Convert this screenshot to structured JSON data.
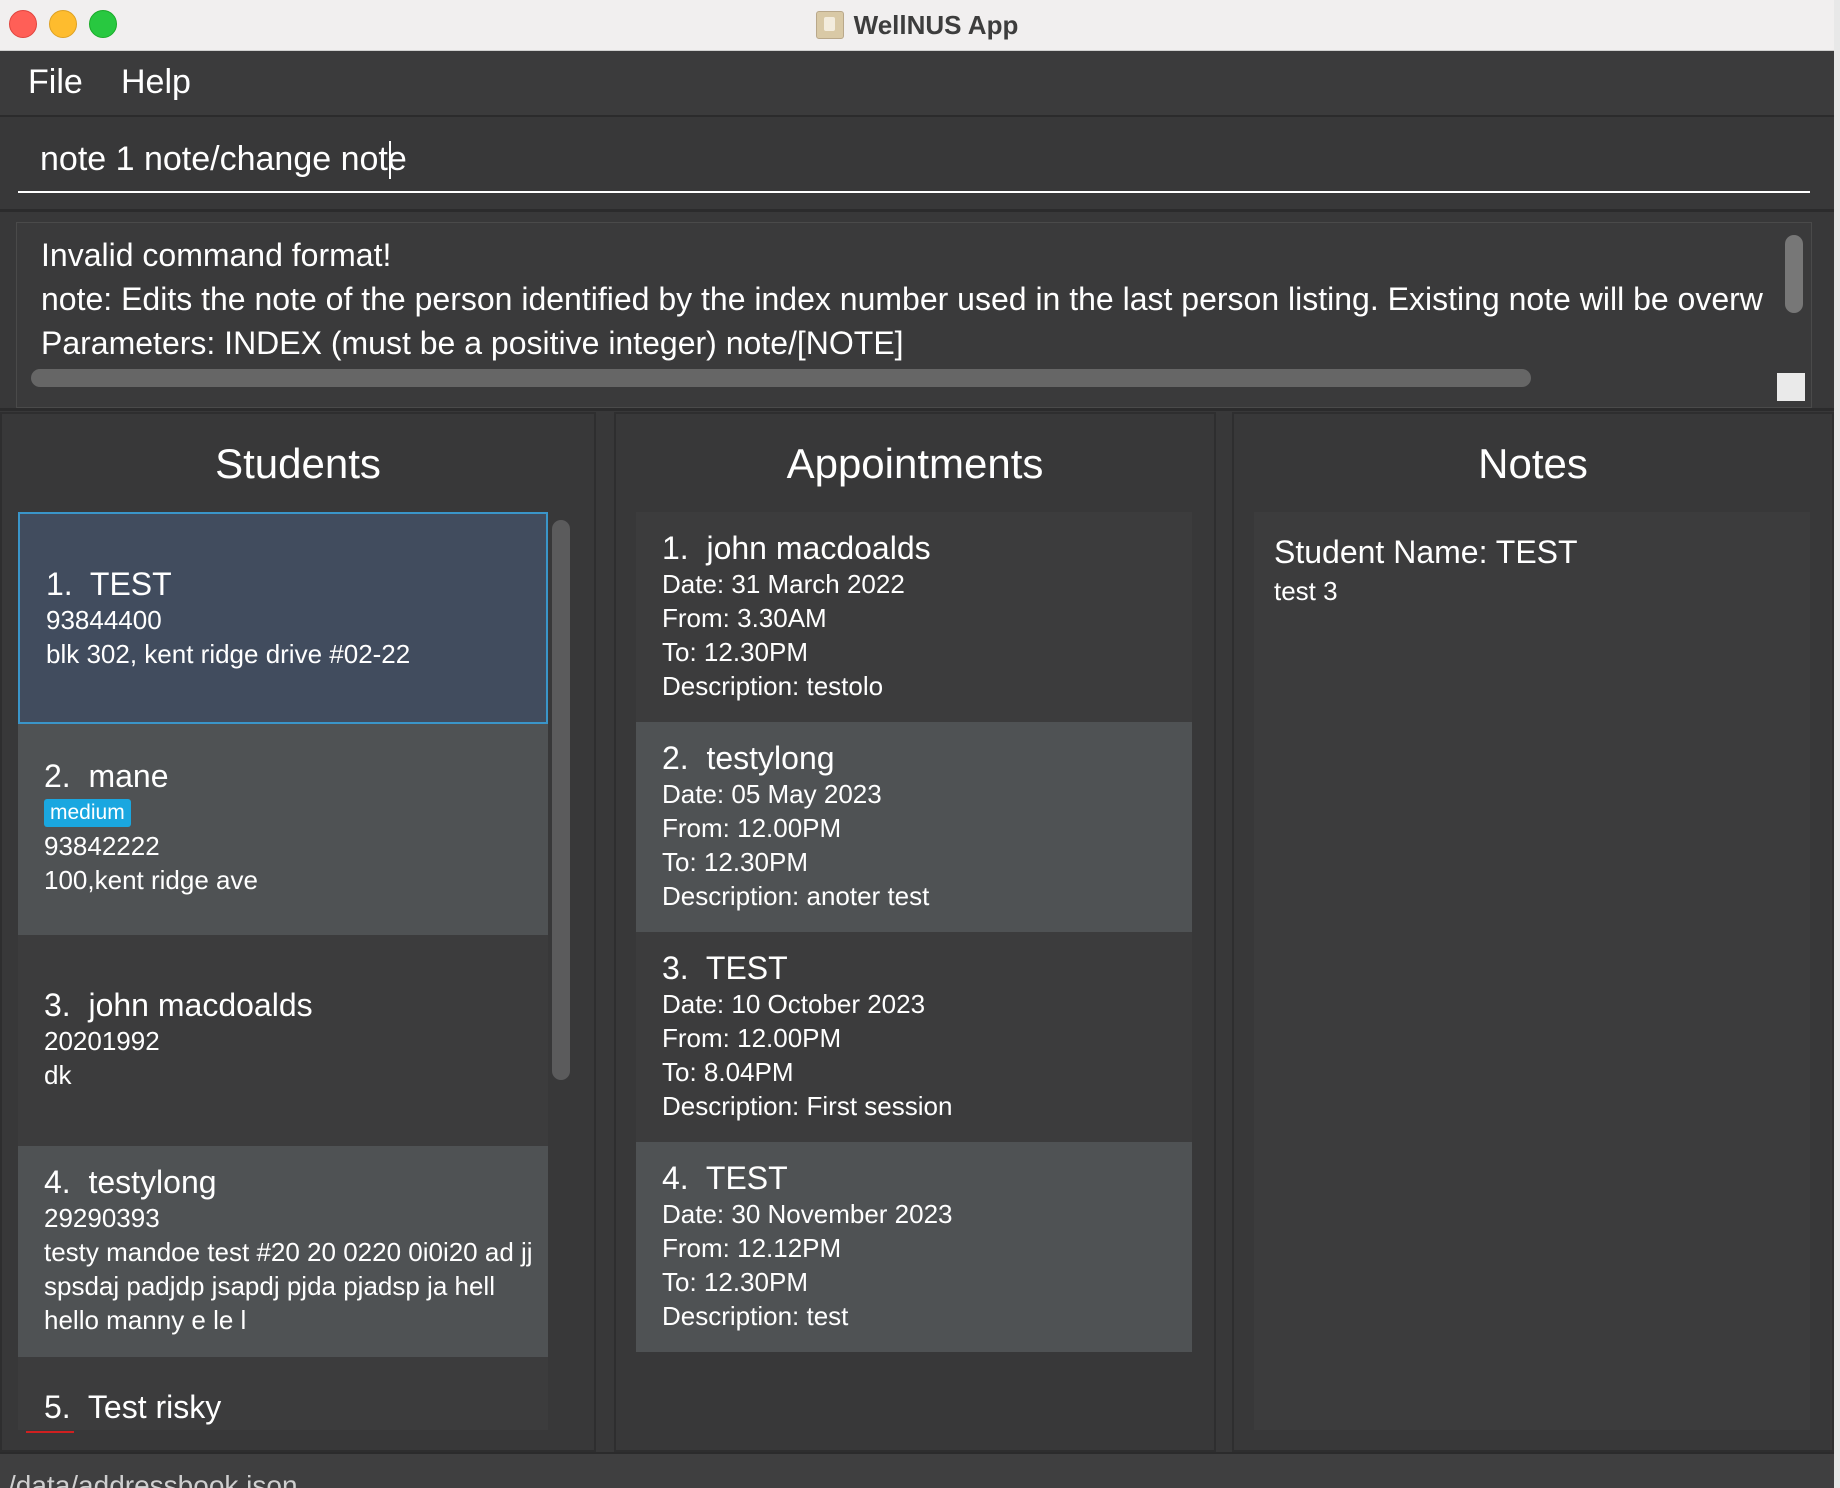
{
  "window": {
    "title": "WellNUS App"
  },
  "menu": {
    "file": "File",
    "help": "Help"
  },
  "command": {
    "value": "note 1 note/change note"
  },
  "result": {
    "line1": "Invalid command format!",
    "line2": "note: Edits the note of the person identified by the index number used in the last person listing. Existing note will be overw",
    "line3": "Parameters: INDEX (must be a positive integer) note/[NOTE]"
  },
  "students": {
    "title": "Students",
    "items": [
      {
        "index": "1.",
        "name": "TEST",
        "phone": "93844400",
        "address": "blk 302, kent ridge drive #02-22"
      },
      {
        "index": "2.",
        "name": "mane",
        "tag": "medium",
        "phone": "93842222",
        "address": "100,kent ridge ave"
      },
      {
        "index": "3.",
        "name": "john macdoalds",
        "phone": "20201992",
        "address": "dk"
      },
      {
        "index": "4.",
        "name": "testylong",
        "phone": "29290393",
        "address": "testy mandoe test #20 20 0220 0i0i20 ad jj spsdaj padjdp jsapdj pjda pjadsp ja hell hello manny e le l"
      },
      {
        "index": "5.",
        "name": "Test risky"
      }
    ]
  },
  "appointments": {
    "title": "Appointments",
    "items": [
      {
        "index": "1.",
        "name": "john macdoalds",
        "date": "Date: 31 March 2022",
        "from": "From: 3.30AM",
        "to": "To: 12.30PM",
        "description": "Description: testolo"
      },
      {
        "index": "2.",
        "name": "testylong",
        "date": "Date: 05 May 2023",
        "from": "From: 12.00PM",
        "to": "To: 12.30PM",
        "description": "Description: anoter test"
      },
      {
        "index": "3.",
        "name": "TEST",
        "date": "Date: 10 October 2023",
        "from": "From: 12.00PM",
        "to": "To: 8.04PM",
        "description": "Description: First session"
      },
      {
        "index": "4.",
        "name": "TEST",
        "date": "Date: 30 November 2023",
        "from": "From: 12.12PM",
        "to": "To: 12.30PM",
        "description": "Description: test"
      }
    ]
  },
  "notes": {
    "title": "Notes",
    "student_name": "Student Name: TEST",
    "body": "test 3"
  },
  "status": {
    "path": "/data/addressbook.json"
  },
  "colors": {
    "selected_border": "#3a95c9",
    "tag": "#1aa7e0",
    "background": "#383839"
  }
}
